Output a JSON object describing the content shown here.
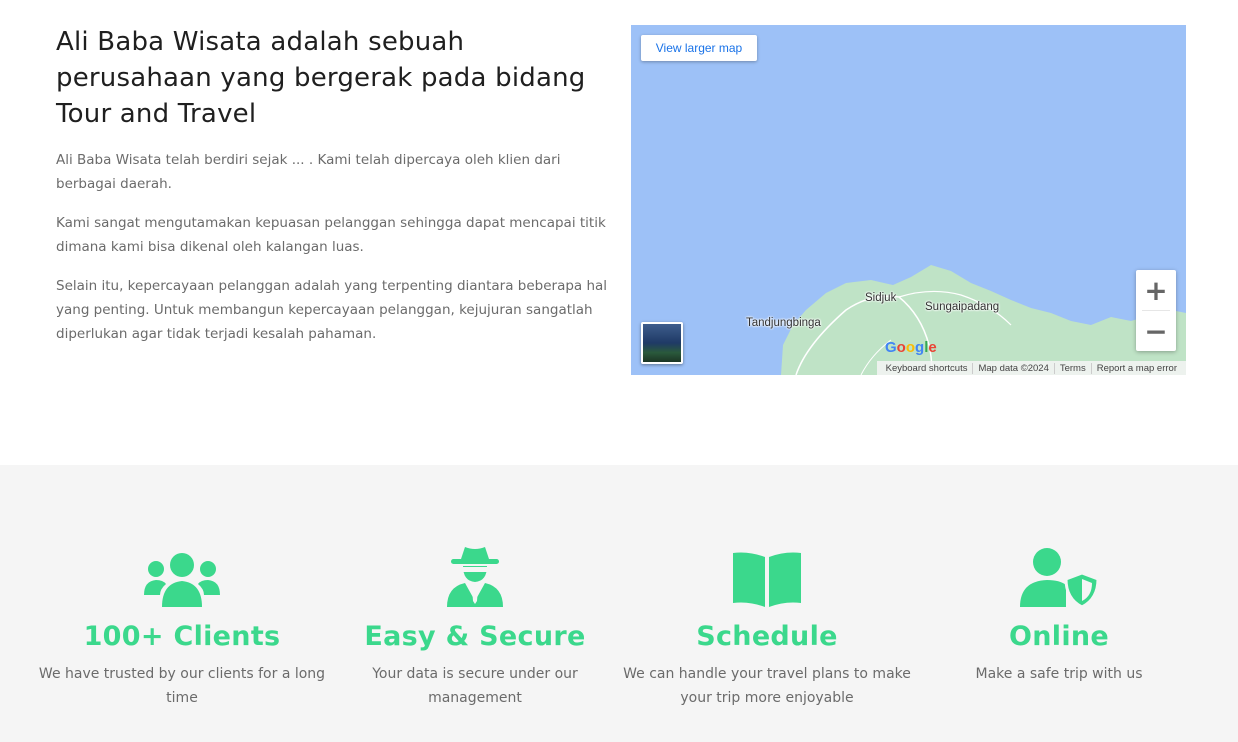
{
  "about": {
    "title": "Ali Baba Wisata adalah sebuah perusahaan yang bergerak pada bidang Tour and Travel",
    "paragraphs": [
      "Ali Baba Wisata telah berdiri sejak ... . Kami telah dipercaya oleh klien dari berbagai daerah.",
      "Kami sangat mengutamakan kepuasan pelanggan sehingga dapat mencapai titik dimana kami bisa dikenal oleh kalangan luas.",
      "Selain itu, kepercayaan pelanggan adalah yang terpenting diantara beberapa hal yang penting. Untuk membangun kepercayaan pelanggan, kejujuran sangatlah diperlukan agar tidak terjadi kesalah pahaman."
    ]
  },
  "map": {
    "larger_map_label": "View larger map",
    "zoom_in": "+",
    "zoom_out": "−",
    "places": [
      "Sidjuk",
      "Sungaipadang",
      "Tandjungbinga"
    ],
    "google": "Google",
    "attribution": [
      "Keyboard shortcuts",
      "Map data ©2024",
      "Terms",
      "Report a map error"
    ],
    "water_color": "#9dc1f7",
    "land_color": "#bfe3c6"
  },
  "features": [
    {
      "icon": "users-icon",
      "title": "100+ Clients",
      "desc": "We have trusted by our clients for a long time"
    },
    {
      "icon": "secret-agent-icon",
      "title": "Easy & Secure",
      "desc": "Your data is secure under our management"
    },
    {
      "icon": "open-book-icon",
      "title": "Schedule",
      "desc": "We can handle your travel plans to make your trip more enjoyable"
    },
    {
      "icon": "user-shield-icon",
      "title": "Online",
      "desc": "Make a safe trip with us"
    }
  ],
  "accent_color": "#3bd88c"
}
